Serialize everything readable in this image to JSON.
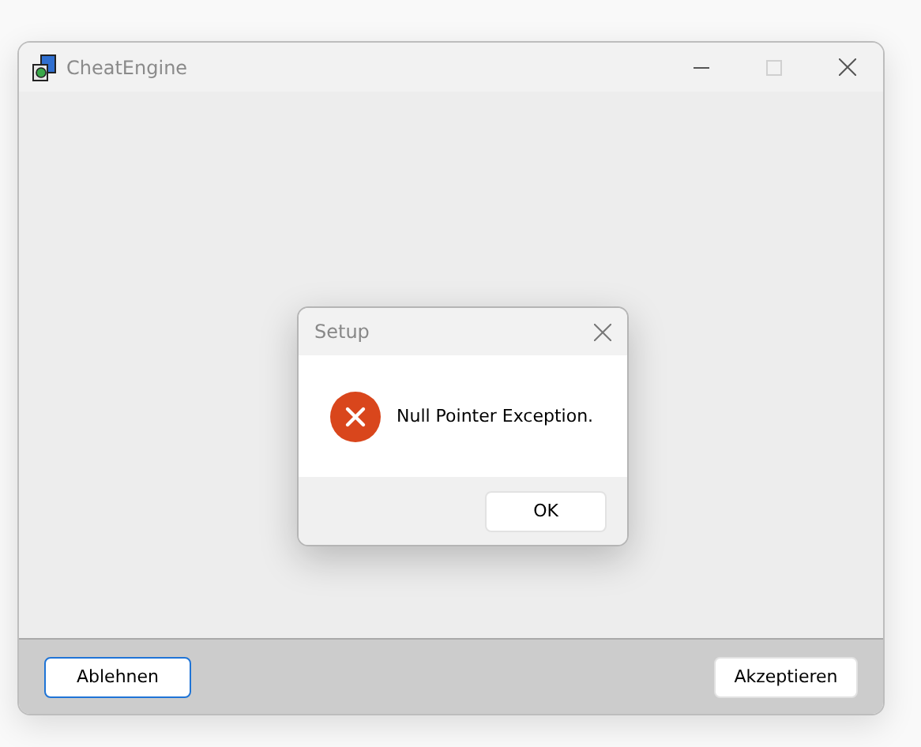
{
  "window": {
    "title": "CheatEngine",
    "maximize_disabled": true
  },
  "dialog": {
    "title": "Setup",
    "message": "Null Pointer Exception.",
    "kind": "error",
    "button": "OK"
  },
  "buttons": [
    {
      "label": "Ablehnen",
      "focused": true
    },
    {
      "label": "Akzeptieren",
      "focused": false
    }
  ]
}
